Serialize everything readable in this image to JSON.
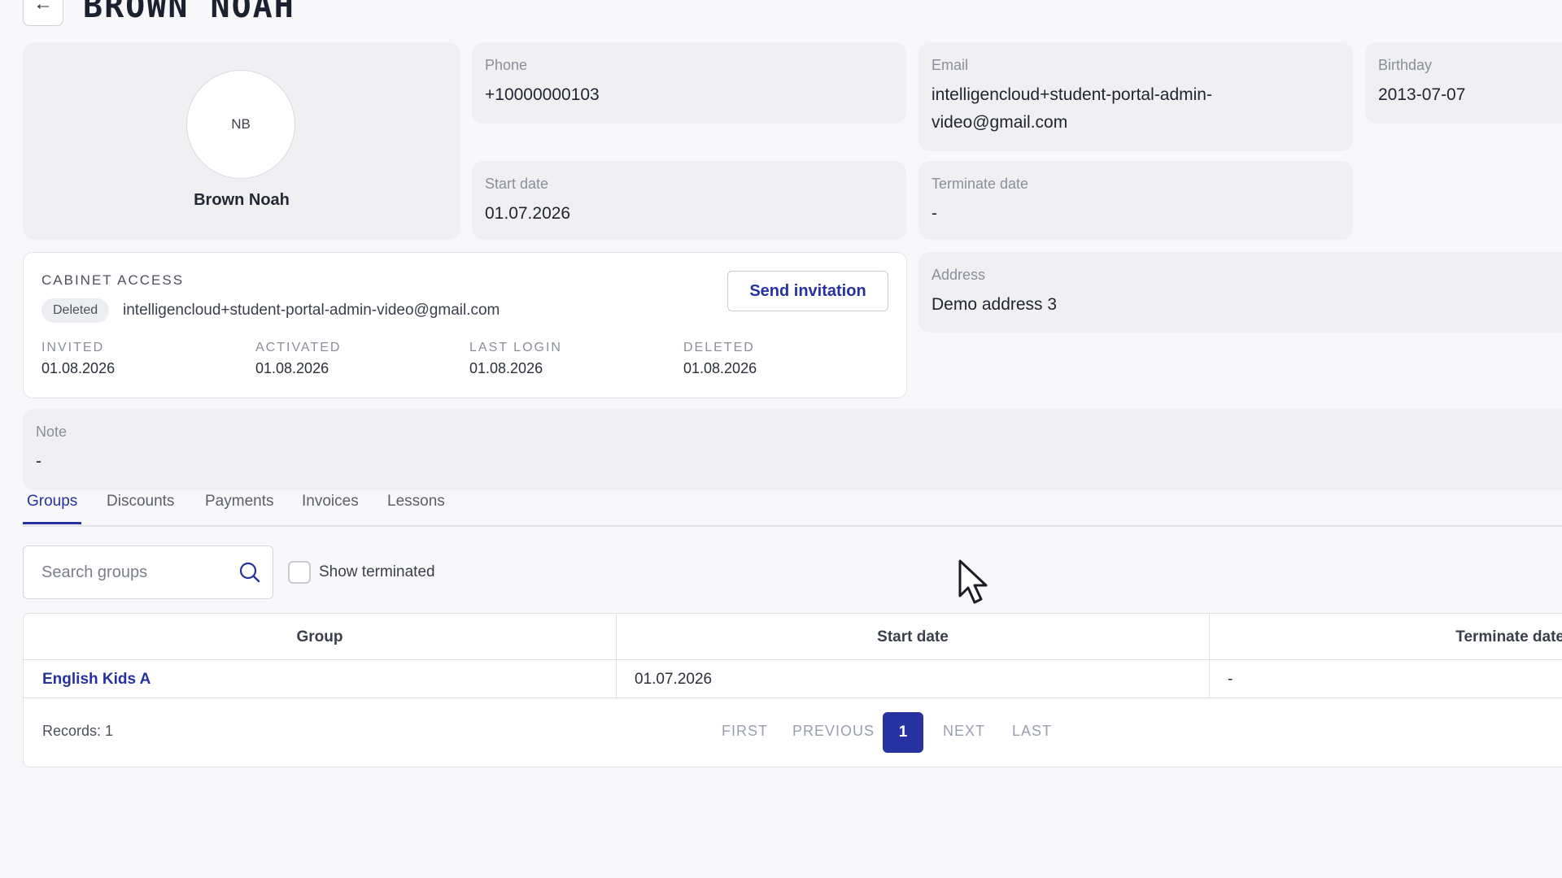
{
  "header": {
    "back_icon": "arrow-left-icon",
    "back_glyph": "←",
    "title": "BROWN NOAH"
  },
  "profile": {
    "initials": "NB",
    "name": "Brown Noah"
  },
  "fields": {
    "phone": {
      "label": "Phone",
      "value": "+10000000103"
    },
    "email": {
      "label": "Email",
      "value_line1": "intelligencloud+student-portal-admin-",
      "value_line2": "video@gmail.com"
    },
    "birthday": {
      "label": "Birthday",
      "value": "2013-07-07"
    },
    "start_date": {
      "label": "Start date",
      "value": "01.07.2026"
    },
    "terminate_date": {
      "label": "Terminate date",
      "value": "-"
    },
    "address": {
      "label": "Address",
      "value": "Demo address 3"
    },
    "note": {
      "label": "Note",
      "value": "-"
    }
  },
  "cabinet": {
    "title": "CABINET ACCESS",
    "status_badge": "Deleted",
    "email": "intelligencloud+student-portal-admin-video@gmail.com",
    "send_invitation_label": "Send invitation",
    "stats": [
      {
        "label": "INVITED",
        "value": "01.08.2026"
      },
      {
        "label": "ACTIVATED",
        "value": "01.08.2026"
      },
      {
        "label": "LAST LOGIN",
        "value": "01.08.2026"
      },
      {
        "label": "DELETED",
        "value": "01.08.2026"
      }
    ]
  },
  "tabs": [
    {
      "label": "Groups",
      "active": true
    },
    {
      "label": "Discounts"
    },
    {
      "label": "Payments"
    },
    {
      "label": "Invoices"
    },
    {
      "label": "Lessons"
    }
  ],
  "search": {
    "placeholder": "Search groups",
    "value": "",
    "icon": "search-icon"
  },
  "filters": {
    "show_terminated_label": "Show terminated",
    "show_terminated_checked": false
  },
  "table": {
    "columns": [
      "Group",
      "Start date",
      "Terminate date"
    ],
    "rows": [
      {
        "group": "English Kids A",
        "start_date": "01.07.2026",
        "terminate_date": "-"
      }
    ],
    "records_text": "Records: 1"
  },
  "pagination": {
    "first": "FIRST",
    "previous": "PREVIOUS",
    "current": "1",
    "next": "NEXT",
    "last": "LAST"
  },
  "colors": {
    "accent": "#2532a0",
    "card_bg": "#f0f0f3",
    "page_bg": "#f8f8fa"
  }
}
